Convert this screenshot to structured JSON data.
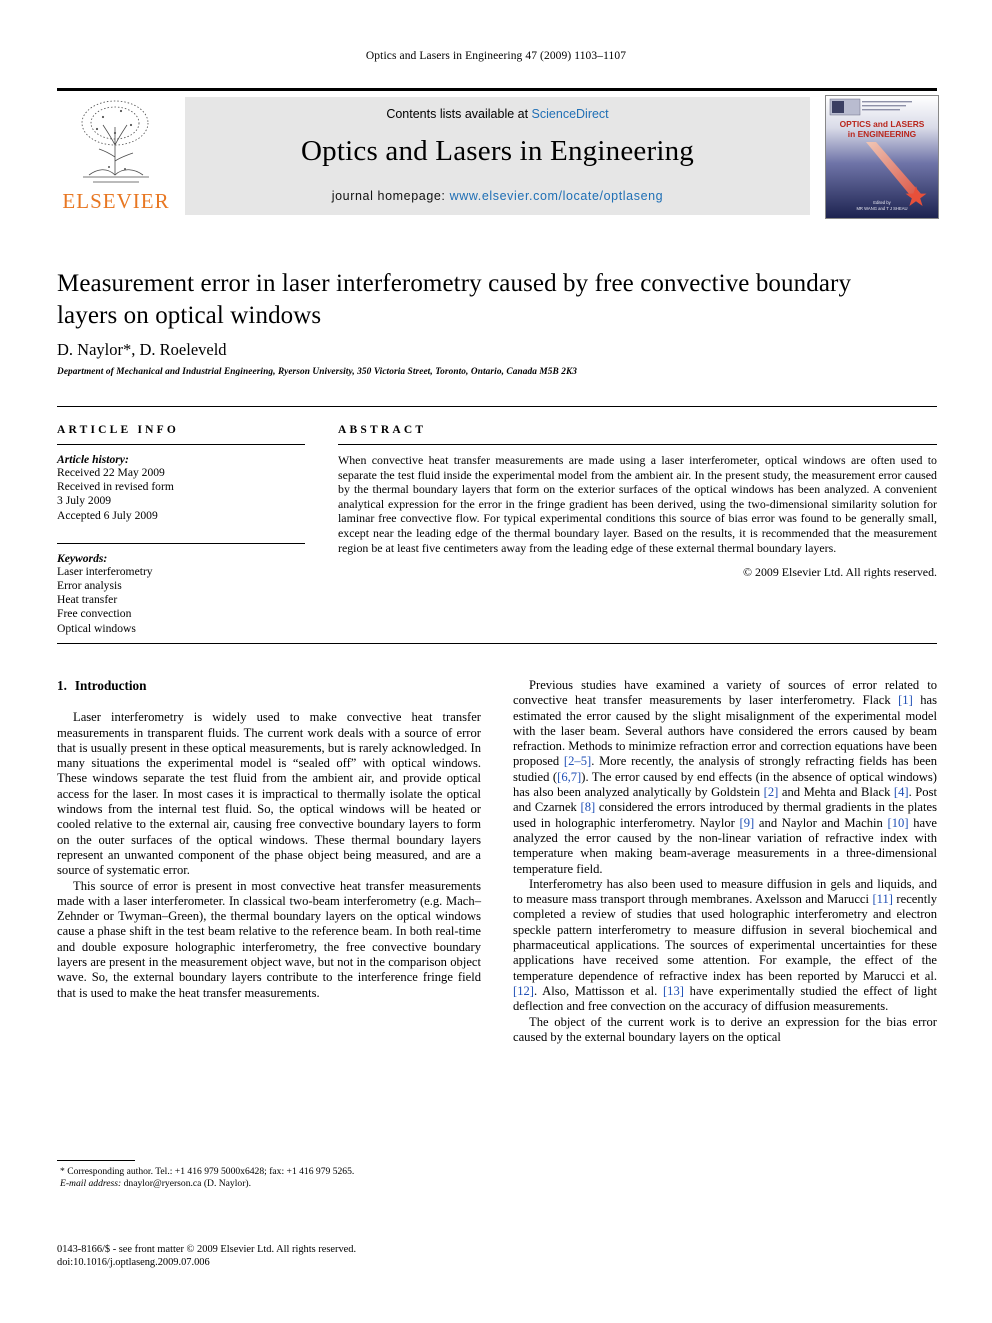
{
  "running_head": "Optics and Lasers in Engineering 47 (2009) 1103–1107",
  "masthead": {
    "publisher_name": "ELSEVIER",
    "contents_prefix": "Contents lists available at ",
    "contents_link": "ScienceDirect",
    "journal_title": "Optics and Lasers in Engineering",
    "homepage_label": "journal homepage: ",
    "homepage_url": "www.elsevier.com/locate/optlaseng",
    "cover_line1": "OPTICS and LASERS",
    "cover_line2": "in ENGINEERING",
    "cover_editor_line1": "Edited by",
    "cover_editor_line2": "MR WANG and T J SHEAU"
  },
  "article": {
    "title": "Measurement error in laser interferometry caused by free convective boundary layers on optical windows",
    "authors": "D. Naylor*, D. Roeleveld",
    "affiliation": "Department of Mechanical and Industrial Engineering, Ryerson University, 350 Victoria Street, Toronto, Ontario, Canada M5B 2K3"
  },
  "article_info": {
    "heading": "ARTICLE INFO",
    "history_label": "Article history:",
    "history_lines": [
      "Received 22 May 2009",
      "Received in revised form",
      "3 July 2009",
      "Accepted 6 July 2009"
    ],
    "keywords_label": "Keywords:",
    "keywords": [
      "Laser interferometry",
      "Error analysis",
      "Heat transfer",
      "Free convection",
      "Optical windows"
    ]
  },
  "abstract": {
    "heading": "ABSTRACT",
    "text": "When convective heat transfer measurements are made using a laser interferometer, optical windows are often used to separate the test fluid inside the experimental model from the ambient air. In the present study, the measurement error caused by the thermal boundary layers that form on the exterior surfaces of the optical windows has been analyzed. A convenient analytical expression for the error in the fringe gradient has been derived, using the two-dimensional similarity solution for laminar free convective flow. For typical experimental conditions this source of bias error was found to be generally small, except near the leading edge of the thermal boundary layer. Based on the results, it is recommended that the measurement region be at least five centimeters away from the leading edge of these external thermal boundary layers.",
    "copyright": "© 2009 Elsevier Ltd. All rights reserved."
  },
  "body": {
    "section_number": "1.",
    "section_title": "Introduction",
    "left_paragraphs": [
      "Laser interferometry is widely used to make convective heat transfer measurements in transparent fluids. The current work deals with a source of error that is usually present in these optical measurements, but is rarely acknowledged. In many situations the experimental model is “sealed off” with optical windows. These windows separate the test fluid from the ambient air, and provide optical access for the laser. In most cases it is impractical to thermally isolate the optical windows from the internal test fluid. So, the optical windows will be heated or cooled relative to the external air, causing free convective boundary layers to form on the outer surfaces of the optical windows. These thermal boundary layers represent an unwanted component of the phase object being measured, and are a source of systematic error.",
      "This source of error is present in most convective heat transfer measurements made with a laser interferometer. In classical two-beam interferometry (e.g. Mach–Zehnder or Twyman–Green), the thermal boundary layers on the optical windows cause a phase shift in the test beam relative to the reference beam. In both real-time and double exposure holographic interferometry, the free convective boundary layers are present in the measurement object wave, but not in the comparison object wave. So, the external boundary layers contribute to the interference fringe field that is used to make the heat transfer measurements."
    ],
    "right_paragraphs": [
      {
        "segments": [
          {
            "t": "Previous studies have examined a variety of sources of error related to convective heat transfer measurements by laser interferometry. Flack ",
            "cite": false
          },
          {
            "t": "[1]",
            "cite": true
          },
          {
            "t": " has estimated the error caused by the slight misalignment of the experimental model with the laser beam. Several authors have considered the errors caused by beam refraction. Methods to minimize refraction error and correction equations have been proposed ",
            "cite": false
          },
          {
            "t": "[2–5]",
            "cite": true
          },
          {
            "t": ". More recently, the analysis of strongly refracting fields has been studied (",
            "cite": false
          },
          {
            "t": "[6,7]",
            "cite": true
          },
          {
            "t": "). The error caused by end effects (in the absence of optical windows) has also been analyzed analytically by Goldstein ",
            "cite": false
          },
          {
            "t": "[2]",
            "cite": true
          },
          {
            "t": " and Mehta and Black ",
            "cite": false
          },
          {
            "t": "[4]",
            "cite": true
          },
          {
            "t": ". Post and Czarnek ",
            "cite": false
          },
          {
            "t": "[8]",
            "cite": true
          },
          {
            "t": " considered the errors introduced by thermal gradients in the plates used in holographic interferometry. Naylor ",
            "cite": false
          },
          {
            "t": "[9]",
            "cite": true
          },
          {
            "t": " and Naylor and Machin ",
            "cite": false
          },
          {
            "t": "[10]",
            "cite": true
          },
          {
            "t": " have analyzed the error caused by the non-linear variation of refractive index with temperature when making beam-average measurements in a three-dimensional temperature field.",
            "cite": false
          }
        ]
      },
      {
        "segments": [
          {
            "t": "Interferometry has also been used to measure diffusion in gels and liquids, and to measure mass transport through membranes. Axelsson and Marucci ",
            "cite": false
          },
          {
            "t": "[11]",
            "cite": true
          },
          {
            "t": " recently completed a review of studies that used holographic interferometry and electron speckle pattern interferometry to measure diffusion in several biochemical and pharmaceutical applications. The sources of experimental uncertainties for these applications have received some attention. For example, the effect of the temperature dependence of refractive index has been reported by Marucci et al. ",
            "cite": false
          },
          {
            "t": "[12]",
            "cite": true
          },
          {
            "t": ". Also, Mattisson et al. ",
            "cite": false
          },
          {
            "t": "[13]",
            "cite": true
          },
          {
            "t": " have experimentally studied the effect of light deflection and free convection on the accuracy of diffusion measurements.",
            "cite": false
          }
        ]
      },
      {
        "segments": [
          {
            "t": "The object of the current work is to derive an expression for the bias error caused by the external boundary layers on the optical",
            "cite": false
          }
        ]
      }
    ]
  },
  "footnote": {
    "line1": "* Corresponding author. Tel.: +1 416 979 5000x6428; fax: +1 416 979 5265.",
    "email_label": "E-mail address:",
    "email_value": " dnaylor@ryerson.ca (D. Naylor)."
  },
  "footer": {
    "line1": "0143-8166/$ - see front matter © 2009 Elsevier Ltd. All rights reserved.",
    "line2": "doi:10.1016/j.optlaseng.2009.07.006"
  }
}
